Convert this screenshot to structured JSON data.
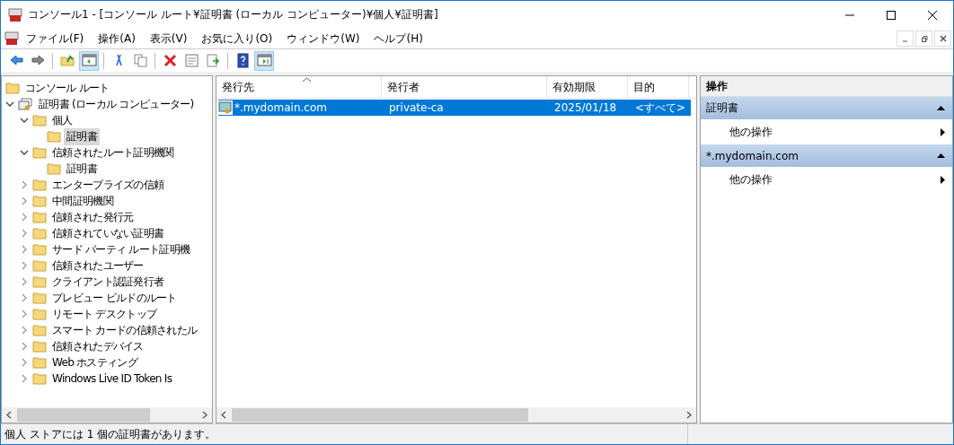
{
  "window": {
    "title": "コンソール1 - [コンソール ルート¥証明書 (ローカル コンピューター)¥個人¥証明書]"
  },
  "menu": [
    "ファイル(F)",
    "操作(A)",
    "表示(V)",
    "お気に入り(O)",
    "ウィンドウ(W)",
    "ヘルプ(H)"
  ],
  "toolbar": [
    {
      "kind": "back",
      "pressed": false
    },
    {
      "kind": "forward",
      "pressed": false
    },
    {
      "kind": "sep"
    },
    {
      "kind": "up",
      "pressed": false
    },
    {
      "kind": "tree",
      "pressed": true
    },
    {
      "kind": "sep"
    },
    {
      "kind": "cut",
      "pressed": false
    },
    {
      "kind": "copy",
      "pressed": false
    },
    {
      "kind": "sep"
    },
    {
      "kind": "delete",
      "pressed": false
    },
    {
      "kind": "properties",
      "pressed": false
    },
    {
      "kind": "export",
      "pressed": false
    },
    {
      "kind": "sep"
    },
    {
      "kind": "help",
      "pressed": false
    },
    {
      "kind": "actionpane",
      "pressed": true
    }
  ],
  "tree": [
    {
      "label": "コンソール ルート",
      "kind": "folder",
      "selected": false,
      "children": [
        {
          "label": "証明書 (ローカル コンピューター)",
          "kind": "store",
          "selected": false,
          "expanded": true,
          "children": [
            {
              "label": "個人",
              "kind": "folder",
              "selected": false,
              "expanded": true,
              "children": [
                {
                  "label": "証明書",
                  "kind": "folder",
                  "selected": true
                }
              ]
            },
            {
              "label": "信頼されたルート証明機関",
              "kind": "folder",
              "selected": false,
              "expanded": true,
              "children": [
                {
                  "label": "証明書",
                  "kind": "folder",
                  "selected": false
                }
              ]
            },
            {
              "label": "エンタープライズの信頼",
              "kind": "folder",
              "selected": false,
              "expanded": false
            },
            {
              "label": "中間証明機関",
              "kind": "folder",
              "selected": false,
              "expanded": false
            },
            {
              "label": "信頼された発行元",
              "kind": "folder",
              "selected": false,
              "expanded": false
            },
            {
              "label": "信頼されていない証明書",
              "kind": "folder",
              "selected": false,
              "expanded": false
            },
            {
              "label": "サード パーティ ルート証明機",
              "kind": "folder",
              "selected": false,
              "expanded": false
            },
            {
              "label": "信頼されたユーザー",
              "kind": "folder",
              "selected": false,
              "expanded": false
            },
            {
              "label": "クライアント認証発行者",
              "kind": "folder",
              "selected": false,
              "expanded": false
            },
            {
              "label": "プレビュー ビルドのルート",
              "kind": "folder",
              "selected": false,
              "expanded": false
            },
            {
              "label": "リモート デスクトップ",
              "kind": "folder",
              "selected": false,
              "expanded": false
            },
            {
              "label": "スマート カードの信頼されたル",
              "kind": "folder",
              "selected": false,
              "expanded": false
            },
            {
              "label": "信頼されたデバイス",
              "kind": "folder",
              "selected": false,
              "expanded": false
            },
            {
              "label": "Web ホスティング",
              "kind": "folder",
              "selected": false,
              "expanded": false
            },
            {
              "label": "Windows Live ID Token Is",
              "kind": "folder",
              "selected": false,
              "expanded": false
            }
          ]
        }
      ]
    }
  ],
  "table": {
    "columns": [
      "発行先",
      "発行者",
      "有効期限",
      "目的"
    ],
    "rows": [
      {
        "cells": [
          "*.mydomain.com",
          "private-ca",
          "2025/01/18",
          "<すべて>"
        ],
        "selected": true
      }
    ]
  },
  "actions": {
    "title": "操作",
    "groups": [
      {
        "title": "証明書",
        "items": [
          "他の操作"
        ]
      },
      {
        "title": "*.mydomain.com",
        "items": [
          "他の操作"
        ]
      }
    ]
  },
  "status_bar": "個人 ストアには 1 個の証明書があります。"
}
